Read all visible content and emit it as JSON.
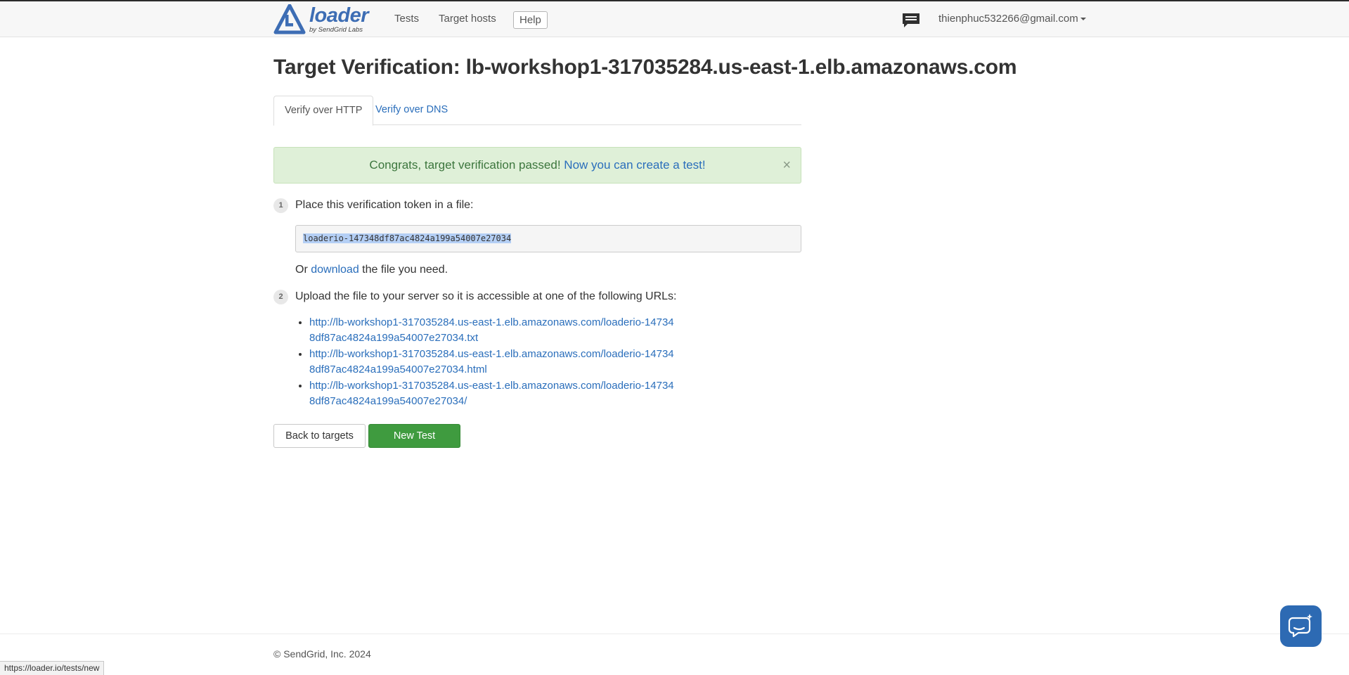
{
  "nav": {
    "brand_name": "loader",
    "brand_sub": "by SendGrid Labs",
    "links": [
      "Tests",
      "Target hosts"
    ],
    "help_label": "Help",
    "user_email": "thienphuc532266@gmail.com"
  },
  "page": {
    "title": "Target Verification: lb-workshop1-317035284.us-east-1.elb.amazonaws.com"
  },
  "tabs": {
    "http_label": "Verify over HTTP",
    "dns_label": "Verify over DNS"
  },
  "alert": {
    "text": "Congrats, target verification passed! ",
    "link": "Now you can create a test!",
    "close": "×"
  },
  "step1": {
    "num": "1",
    "text": "Place this verification token in a file:",
    "token": "loaderio-147348df87ac4824a199a54007e27034",
    "or_prefix": "Or ",
    "download_link": "download",
    "or_suffix": " the file you need."
  },
  "step2": {
    "num": "2",
    "text": "Upload the file to your server so it is accessible at one of the following URLs:",
    "urls": [
      "http://lb-workshop1-317035284.us-east-1.elb.amazonaws.com/loaderio-147348df87ac4824a199a54007e27034.txt",
      "http://lb-workshop1-317035284.us-east-1.elb.amazonaws.com/loaderio-147348df87ac4824a199a54007e27034.html",
      "http://lb-workshop1-317035284.us-east-1.elb.amazonaws.com/loaderio-147348df87ac4824a199a54007e27034/"
    ]
  },
  "buttons": {
    "back_label": "Back to targets",
    "new_label": "New Test"
  },
  "footer": {
    "copyright": "© SendGrid, Inc. 2024"
  },
  "status_bar": {
    "url": "https://loader.io/tests/new"
  },
  "colors": {
    "brand": "#3d6db4",
    "link": "#2a6ebb",
    "success_bg": "#dff0d8",
    "success_text": "#3c763d",
    "primary_button": "#3f9b3f",
    "chat_bubble": "#2d6ab3"
  },
  "icons": {
    "logo": "loader-logo-icon",
    "chat": "chat-icon",
    "support": "support-chat-icon"
  }
}
